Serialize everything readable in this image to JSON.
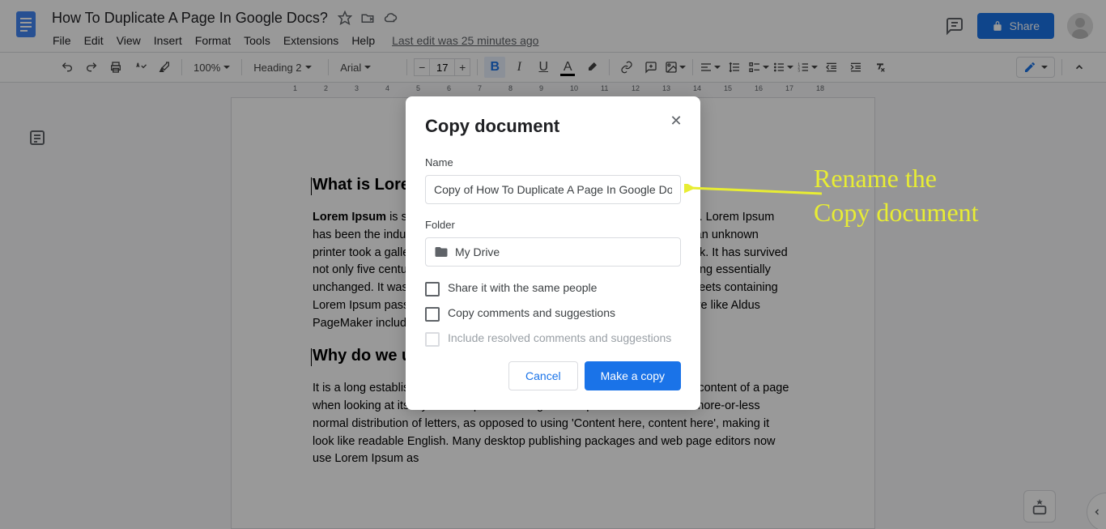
{
  "header": {
    "doc_title": "How To Duplicate A Page In Google Docs?",
    "last_edit": "Last edit was 25 minutes ago",
    "share_label": "Share"
  },
  "menu": [
    "File",
    "Edit",
    "View",
    "Insert",
    "Format",
    "Tools",
    "Extensions",
    "Help"
  ],
  "toolbar": {
    "zoom": "100%",
    "style": "Heading 2",
    "font": "Arial",
    "font_size": "17"
  },
  "ruler_marks": [
    1,
    2,
    3,
    4,
    5,
    6,
    7,
    8,
    9,
    10,
    11,
    12,
    13,
    14,
    15,
    16,
    17,
    18
  ],
  "document": {
    "h2_1": "What is Lorem Ipsum?",
    "p1_bold": "Lorem Ipsum",
    "p1": " is simply dummy text of the printing and typesetting industry. Lorem Ipsum has been the industry's standard dummy text ever since the 1500s, when an unknown printer took a galley of type and scrambled it to make a type specimen book. It has survived not only five centuries, but also the leap into electronic typesetting, remaining essentially unchanged. It was popularised in the 1960s with the release of Letraset sheets containing Lorem Ipsum passages, and more recently with desktop publishing software like Aldus PageMaker including versions of Lorem Ipsum.",
    "h2_2": "Why do we use it?",
    "p2": "It is a long established fact that a reader will be distracted by the readable content of a page when looking at its layout. The point of using Lorem Ipsum is that it has a more-or-less normal distribution of letters, as opposed to using 'Content here, content here', making it look like readable English. Many desktop publishing packages and web page editors now use Lorem Ipsum as"
  },
  "modal": {
    "title": "Copy document",
    "name_label": "Name",
    "name_value": "Copy of How To Duplicate A Page In Google Docs?",
    "folder_label": "Folder",
    "folder_value": "My Drive",
    "check1": "Share it with the same people",
    "check2": "Copy comments and suggestions",
    "check3": "Include resolved comments and suggestions",
    "cancel": "Cancel",
    "confirm": "Make a copy"
  },
  "annotation": {
    "line1": "Rename the",
    "line2": "Copy document"
  }
}
